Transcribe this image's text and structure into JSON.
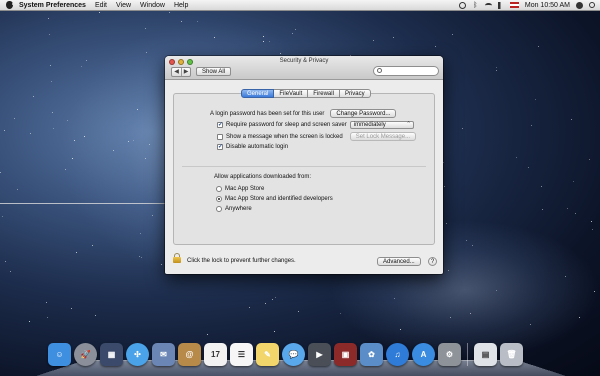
{
  "menubar": {
    "app_name": "System Preferences",
    "items": [
      "Edit",
      "View",
      "Window",
      "Help"
    ],
    "clock": "Mon 10:50 AM",
    "status_icons": [
      "time-machine-icon",
      "bluetooth-icon",
      "wifi-icon",
      "volume-icon",
      "flag-icon",
      "user-icon",
      "spotlight-icon"
    ]
  },
  "window": {
    "title": "Security & Privacy",
    "toolbar": {
      "back": "◀",
      "forward": "▶",
      "show_all": "Show All",
      "search_placeholder": ""
    },
    "tabs": [
      {
        "label": "General",
        "active": true
      },
      {
        "label": "FileVault",
        "active": false
      },
      {
        "label": "Firewall",
        "active": false
      },
      {
        "label": "Privacy",
        "active": false
      }
    ],
    "general": {
      "login_password_text": "A login password has been set for this user",
      "change_password": "Change Password...",
      "require_password": {
        "label": "Require password for sleep and screen saver",
        "checked": true,
        "value": "immediately"
      },
      "show_message": {
        "label": "Show a message when the screen is locked",
        "checked": false,
        "button": "Set Lock Message..."
      },
      "disable_auto_login": {
        "label": "Disable automatic login",
        "checked": true
      },
      "allow_apps_heading": "Allow applications downloaded from:",
      "options": [
        {
          "label": "Mac App Store",
          "selected": false
        },
        {
          "label": "Mac App Store and identified developers",
          "selected": true
        },
        {
          "label": "Anywhere",
          "selected": false
        }
      ]
    },
    "footer": {
      "lock_text": "Click the lock to prevent further changes.",
      "advanced": "Advanced...",
      "help": "?"
    }
  },
  "dock": {
    "apps": [
      {
        "name": "finder-icon",
        "color": "#3f8fe0",
        "glyph": "☺",
        "round": false
      },
      {
        "name": "launchpad-icon",
        "color": "#8a8f99",
        "glyph": "🚀",
        "round": true
      },
      {
        "name": "mission-control-icon",
        "color": "#3b4a6b",
        "glyph": "▦",
        "round": false
      },
      {
        "name": "safari-icon",
        "color": "#4aa3e8",
        "glyph": "✣",
        "round": true
      },
      {
        "name": "mail-icon",
        "color": "#6b86b5",
        "glyph": "✉",
        "round": false
      },
      {
        "name": "contacts-icon",
        "color": "#b88a4a",
        "glyph": "@",
        "round": false
      },
      {
        "name": "calendar-icon",
        "color": "#f2f2f2",
        "glyph": "17",
        "round": false
      },
      {
        "name": "reminders-icon",
        "color": "#f6f6f6",
        "glyph": "☰",
        "round": false
      },
      {
        "name": "notes-icon",
        "color": "#f2d66b",
        "glyph": "✎",
        "round": false
      },
      {
        "name": "messages-icon",
        "color": "#5aa8ec",
        "glyph": "💬",
        "round": true
      },
      {
        "name": "facetime-icon",
        "color": "#4a4f57",
        "glyph": "▶",
        "round": false
      },
      {
        "name": "photo-booth-icon",
        "color": "#8c2a2a",
        "glyph": "▣",
        "round": false
      },
      {
        "name": "iphoto-icon",
        "color": "#5b8ec9",
        "glyph": "✿",
        "round": false
      },
      {
        "name": "itunes-icon",
        "color": "#2f7bd8",
        "glyph": "♫",
        "round": true
      },
      {
        "name": "app-store-icon",
        "color": "#3a8ce0",
        "glyph": "A",
        "round": true
      },
      {
        "name": "system-preferences-icon",
        "color": "#8e9399",
        "glyph": "⚙",
        "round": false
      }
    ],
    "stacks": [
      {
        "name": "documents-stack-icon",
        "color": "#dfe3e8",
        "glyph": "▤",
        "round": false
      },
      {
        "name": "trash-icon",
        "color": "#b9bec6",
        "glyph": "🗑",
        "round": false
      }
    ]
  }
}
